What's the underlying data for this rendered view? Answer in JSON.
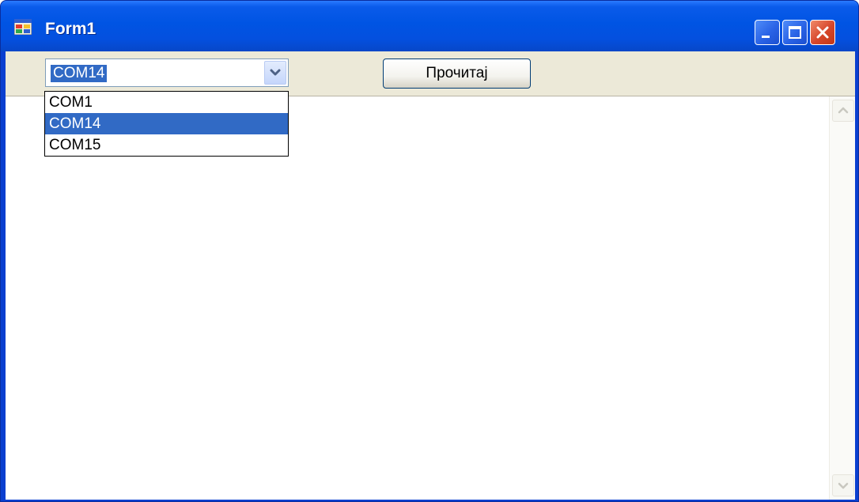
{
  "window": {
    "title": "Form1",
    "icon": "form-app-icon",
    "controls": [
      "minimize-icon",
      "maximize-icon",
      "close-icon"
    ]
  },
  "port_combo": {
    "value": "COM14",
    "options": [
      "COM1",
      "COM14",
      "COM15"
    ],
    "selected_index": 1,
    "expanded": true
  },
  "read_button": {
    "label": "Прочитај"
  },
  "output_textbox": {
    "value": "",
    "scrollbar": "vertical"
  },
  "colors": {
    "titlebar": "#0054e3",
    "selection": "#316ac5",
    "toolbar_bg": "#ece9d8"
  }
}
